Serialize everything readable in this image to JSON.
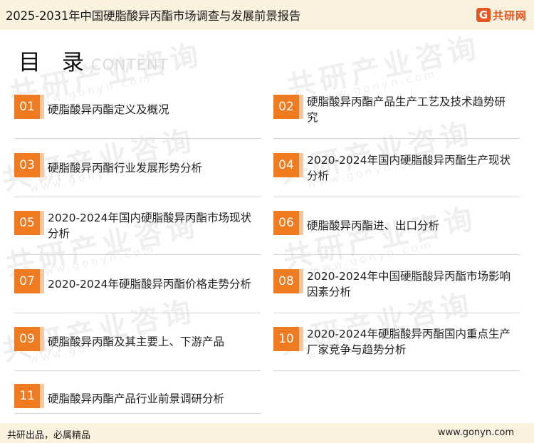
{
  "header": {
    "title": "2025-2031年中国硬脂酸异丙酯市场调查与发展前景报告",
    "logo_text": "共研网"
  },
  "heading": {
    "title": "目 录",
    "subtitle": "CONTENT"
  },
  "watermark": {
    "text": "共研产业咨询",
    "url_text": "www.gonyn.com"
  },
  "colors": {
    "accent": "#f07a1f",
    "accent_light": "#f9c79e",
    "band": "#fbf1df",
    "logo": "#e8541e"
  },
  "toc": [
    {
      "num": "01",
      "title": "硬脂酸异丙酯定义及概况"
    },
    {
      "num": "02",
      "title": "硬脂酸异丙酯产品生产工艺及技术趋势研究"
    },
    {
      "num": "03",
      "title": "硬脂酸异丙酯行业发展形势分析"
    },
    {
      "num": "04",
      "title": "2020-2024年国内硬脂酸异丙酯生产现状分析"
    },
    {
      "num": "05",
      "title": "2020-2024年国内硬脂酸异丙酯市场现状分析"
    },
    {
      "num": "06",
      "title": "硬脂酸异丙酯进、出口分析"
    },
    {
      "num": "07",
      "title": "2020-2024年硬脂酸异丙酯价格走势分析"
    },
    {
      "num": "08",
      "title": "2020-2024年中国硬脂酸异丙酯市场影响因素分析"
    },
    {
      "num": "09",
      "title": "硬脂酸异丙酯及其主要上、下游产品"
    },
    {
      "num": "10",
      "title": "2020-2024年硬脂酸异丙酯国内重点生产厂家竞争与趋势分析"
    },
    {
      "num": "11",
      "title": "硬脂酸异丙酯产品行业前景调研分析"
    }
  ],
  "footer": {
    "slogan": "共研出品，必属精品",
    "website": "www.gonyn.com"
  }
}
